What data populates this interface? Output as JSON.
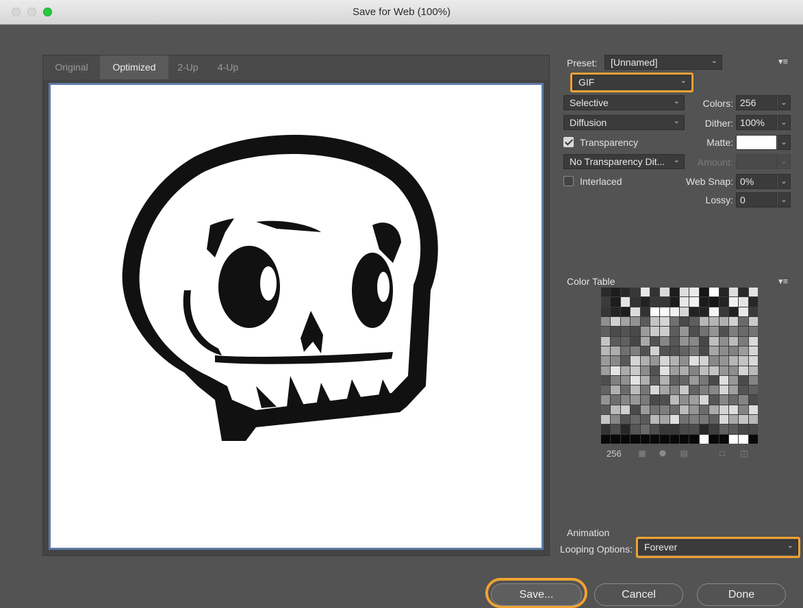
{
  "window": {
    "title": "Save for Web (100%)"
  },
  "preview": {
    "tabs": [
      {
        "label": "Original"
      },
      {
        "label": "Optimized"
      },
      {
        "label": "2-Up"
      },
      {
        "label": "4-Up"
      }
    ]
  },
  "settings": {
    "preset_label": "Preset:",
    "preset_value": "[Unnamed]",
    "format": "GIF",
    "reduction": "Selective",
    "dither_algo": "Diffusion",
    "transparency_dither": "No Transparency Dit...",
    "colors_label": "Colors:",
    "colors_value": "256",
    "dither_label": "Dither:",
    "dither_value": "100%",
    "transparency_label": "Transparency",
    "transparency_checked": true,
    "matte_label": "Matte:",
    "matte_color": "#ffffff",
    "amount_label": "Amount:",
    "amount_value": "",
    "interlaced_label": "Interlaced",
    "interlaced_checked": false,
    "websnap_label": "Web Snap:",
    "websnap_value": "0%",
    "lossy_label": "Lossy:",
    "lossy_value": "0"
  },
  "color_table": {
    "title": "Color Table",
    "count": "256",
    "footer_icons": [
      "map-to-transparent-icon",
      "web-shift-icon",
      "lock-color-icon",
      "new-color-icon",
      "delete-color-icon"
    ]
  },
  "animation": {
    "title": "Animation",
    "looping_label": "Looping Options:",
    "looping_value": "Forever"
  },
  "buttons": {
    "save": "Save...",
    "cancel": "Cancel",
    "done": "Done"
  },
  "colors": {
    "highlight": "#f0a233",
    "canvas_border": "#5e7aa6",
    "dialog_bg": "#535353"
  }
}
